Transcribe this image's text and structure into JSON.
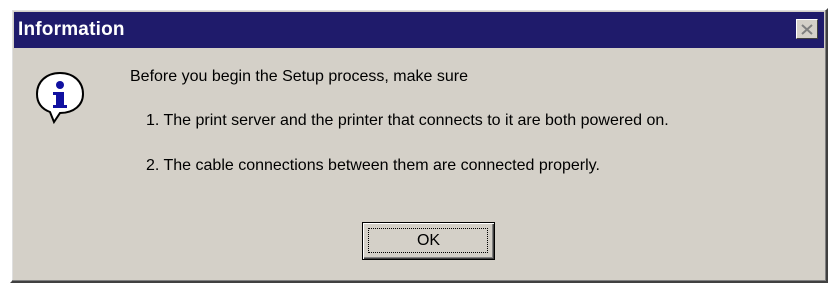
{
  "window": {
    "title": "Information",
    "close_icon": "close-icon",
    "colors": {
      "titlebar": "#1f1b6b",
      "face": "#d4d0c8"
    }
  },
  "icon": "info-icon",
  "message": {
    "intro": "Before you begin the Setup process, make sure",
    "items": [
      "1. The print server and the printer that connects to it are both powered on.",
      "2. The cable connections between them are connected properly."
    ]
  },
  "buttons": {
    "ok_label": "OK"
  }
}
